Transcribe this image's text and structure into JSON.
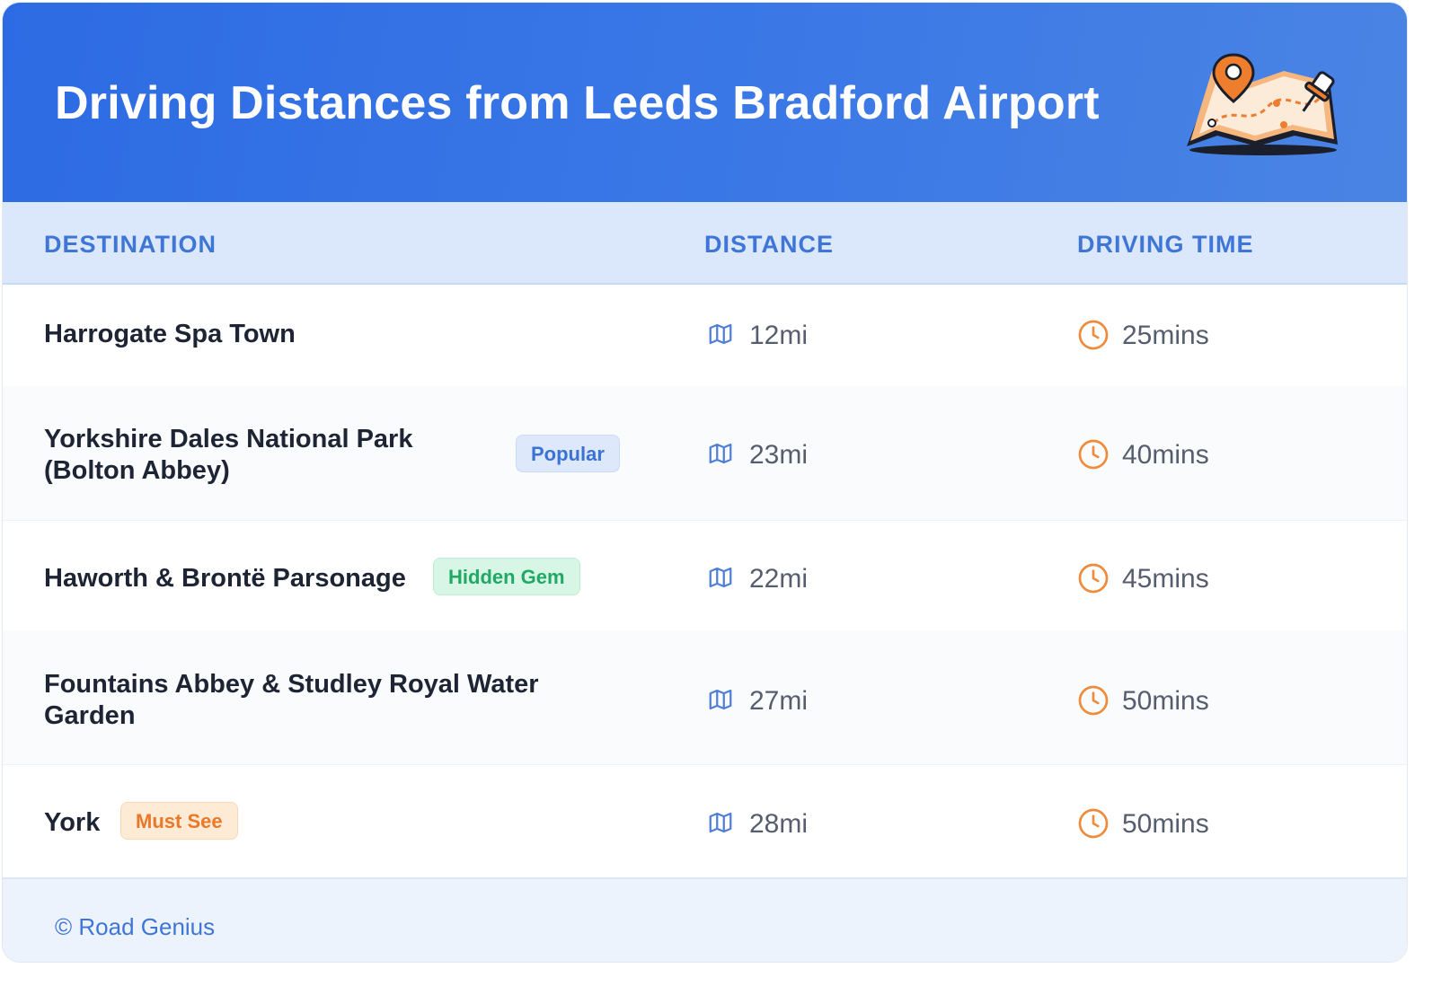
{
  "header": {
    "title": "Driving Distances from Leeds Bradford Airport",
    "illustration": "map-with-pin-icon"
  },
  "columns": {
    "destination": "DESTINATION",
    "distance": "DISTANCE",
    "driving_time": "DRIVING TIME"
  },
  "rows": [
    {
      "destination": "Harrogate Spa Town",
      "badge": "",
      "distance": "12mi",
      "time": "25mins"
    },
    {
      "destination": "Yorkshire Dales National Park (Bolton Abbey)",
      "badge": "Popular",
      "distance": "23mi",
      "time": "40mins"
    },
    {
      "destination": "Haworth & Brontë Parsonage",
      "badge": "Hidden Gem",
      "distance": "22mi",
      "time": "45mins"
    },
    {
      "destination": "Fountains Abbey & Studley Royal Water Garden",
      "badge": "",
      "distance": "27mi",
      "time": "50mins"
    },
    {
      "destination": "York",
      "badge": "Must See",
      "distance": "28mi",
      "time": "50mins"
    }
  ],
  "icons": {
    "distance": "map-icon",
    "time": "clock-icon"
  },
  "footer": {
    "text": "© Road Genius"
  },
  "colors": {
    "header_bg": "#2d6be4",
    "accent_blue": "#3f76d6",
    "accent_orange": "#ef8b3a",
    "popular_badge": "#dde9fb",
    "hidden_gem_badge": "#d8f6e6",
    "must_see_badge": "#fdebd5"
  }
}
